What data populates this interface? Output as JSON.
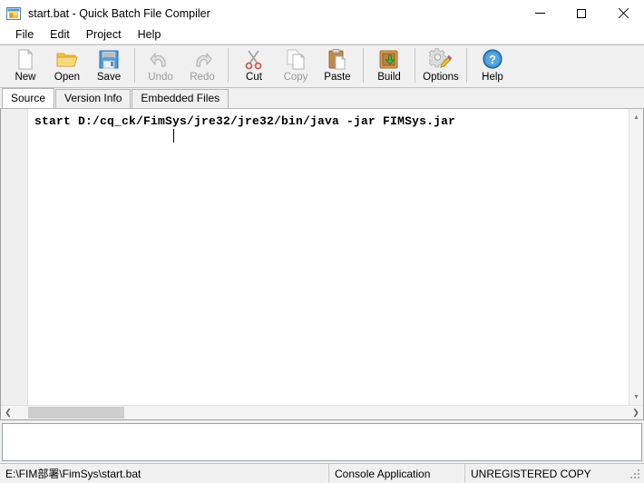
{
  "window": {
    "title": "start.bat - Quick Batch File Compiler",
    "icon": "app-window-icon",
    "controls": {
      "minimize": "minimize-icon",
      "maximize": "maximize-icon",
      "close": "close-icon"
    }
  },
  "menubar": {
    "items": [
      {
        "label": "File"
      },
      {
        "label": "Edit"
      },
      {
        "label": "Project"
      },
      {
        "label": "Help"
      }
    ]
  },
  "toolbar": {
    "buttons": [
      {
        "label": "New",
        "icon": "new-document-icon",
        "enabled": true
      },
      {
        "label": "Open",
        "icon": "open-folder-icon",
        "enabled": true
      },
      {
        "label": "Save",
        "icon": "save-floppy-icon",
        "enabled": true
      },
      {
        "label": "Undo",
        "icon": "undo-arrow-icon",
        "enabled": false
      },
      {
        "label": "Redo",
        "icon": "redo-arrow-icon",
        "enabled": false
      },
      {
        "label": "Cut",
        "icon": "scissors-icon",
        "enabled": true
      },
      {
        "label": "Copy",
        "icon": "copy-pages-icon",
        "enabled": false
      },
      {
        "label": "Paste",
        "icon": "clipboard-icon",
        "enabled": true
      },
      {
        "label": "Build",
        "icon": "build-box-icon",
        "enabled": true
      },
      {
        "label": "Options",
        "icon": "gear-pencil-icon",
        "enabled": true
      },
      {
        "label": "Help",
        "icon": "help-question-icon",
        "enabled": true
      }
    ]
  },
  "tabs": {
    "items": [
      {
        "label": "Source",
        "active": true
      },
      {
        "label": "Version Info",
        "active": false
      },
      {
        "label": "Embedded Files",
        "active": false
      }
    ]
  },
  "editor": {
    "lines": [
      "start D:/cq_ck/FimSys/jre32/jre32/bin/java -jar FIMSys.jar"
    ],
    "caret": {
      "line": 2,
      "column": 13
    },
    "scrollbars": {
      "vertical_up": "scroll-up-arrow-icon",
      "vertical_down": "scroll-down-arrow-icon",
      "horizontal_left": "scroll-left-arrow-icon",
      "horizontal_right": "scroll-right-arrow-icon"
    }
  },
  "statusbar": {
    "path": "E:\\FIM部署\\FimSys\\start.bat",
    "app_type": "Console Application",
    "registration": "UNREGISTERED COPY"
  },
  "colors": {
    "window_bg": "#f0f0f0",
    "editor_bg": "#ffffff",
    "accent_blue": "#3c93d4",
    "folder_yellow": "#f5c550",
    "build_brown": "#c88a42",
    "scissors_red": "#d0504a"
  }
}
